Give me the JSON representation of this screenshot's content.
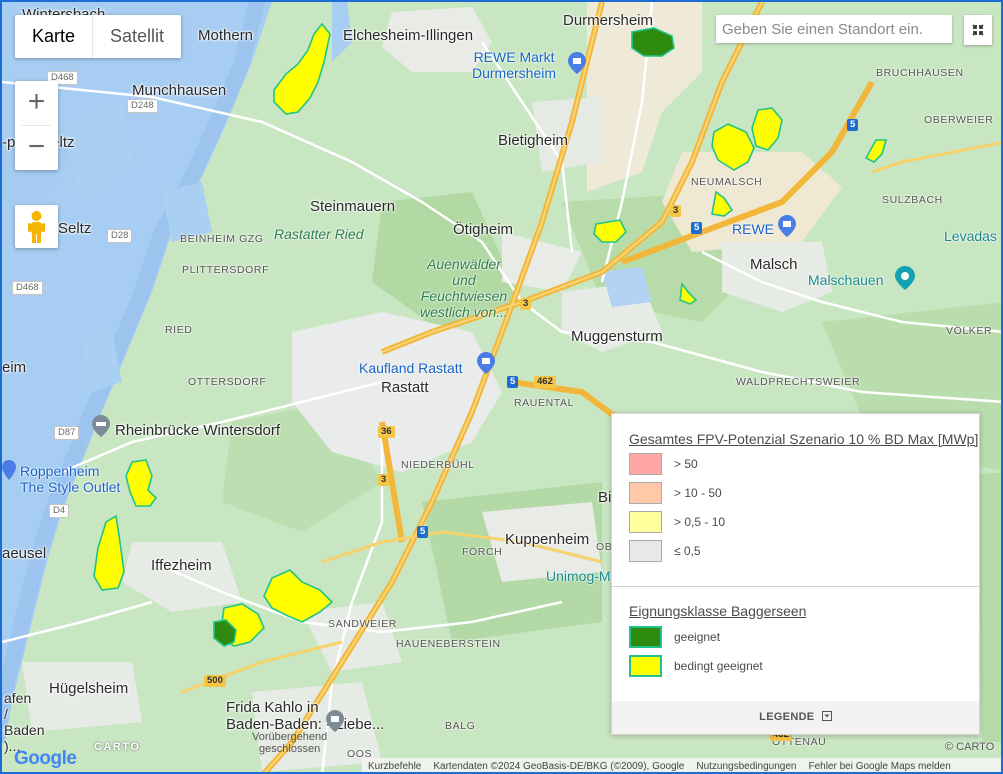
{
  "map_type": {
    "options": [
      "Karte",
      "Satellit"
    ],
    "selected": "Karte"
  },
  "zoom": {
    "in_label": "+",
    "out_label": "−"
  },
  "search": {
    "placeholder": "Geben Sie einen Standort ein."
  },
  "places": {
    "wintersbach": "Wintersbach",
    "mothern": "Mothern",
    "elchesheim": "Elchesheim-Illingen",
    "durmersheim": "Durmersheim",
    "rewe_markt": "REWE Markt\nDurmersheim",
    "munchhausen": "Munchhausen",
    "pres_seltz": "-près-Seltz",
    "bietigheim": "Bietigheim",
    "bruchhausen": "BRUCHHAUSEN",
    "oberweier": "OBERWEIER",
    "neumalsch": "NEUMALSCH",
    "sulzbach": "SULZBACH",
    "steinmauern": "Steinmauern",
    "rastatter_ried": "Rastatter Ried",
    "otigheim": "Ötigheim",
    "rewe": "REWE",
    "levadas": "Levadas",
    "seltz": "Seltz",
    "beinheim": "BEINHEIM GZG",
    "plittersdorf": "PLITTERSDORF",
    "auenwalder": "Auenwälder\nund\nFeuchtwiesen\nwestlich von...",
    "malsch": "Malsch",
    "malschauen": "Malschauen",
    "ried": "RIED",
    "muggensturm": "Muggensturm",
    "volker": "VÖLKER",
    "kaufland": "Kaufland Rastatt",
    "rastatt": "Rastatt",
    "ottersdorf": "OTTERSDORF",
    "waldprechtsweier": "WALDPRECHTSWEIER",
    "rauental": "RAUENTAL",
    "rheinbrucke": "Rheinbrücke Wintersdorf",
    "niederbuhl": "NIEDERBÜHL",
    "roppenheim": "Roppenheim\nThe Style Outlet",
    "iffezheim": "Iffezheim",
    "forch": "FÖRCH",
    "kuppenheim": "Kuppenheim",
    "unimog": "Unimog-M",
    "aeusel": "aeusel",
    "sandweier": "SANDWEIER",
    "haueneberstein": "HAUENEBERSTEIN",
    "hugelsheim": "Hügelsheim",
    "frida": "Frida Kahlo in\nBaden-Baden: - Liebe...",
    "frida_status": "Vorübergehend\ngeschlossen",
    "balg": "BALG",
    "oos": "OOS",
    "ottenau": "OTTENAU",
    "left_edge": "afen\n/\nBaden\n)...",
    "ch": "eim",
    "bi": "Bi",
    "ob": "OB"
  },
  "road_labels": {
    "d468a": "D468",
    "d248": "D248",
    "d28": "D28",
    "d468b": "D468",
    "d87": "D87",
    "d4": "D4",
    "a5a": "5",
    "a5b": "5",
    "a5c": "5",
    "a5d": "5",
    "b3a": "3",
    "b3b": "3",
    "b3c": "3",
    "b36": "36",
    "b462": "462",
    "b500": "500",
    "k462": "462"
  },
  "legend": {
    "title1": "Gesamtes FPV-Potenzial Szenario 10 % BD Max [MWp]",
    "classes": [
      {
        "label": "> 50",
        "color": "#ffa6a6"
      },
      {
        "label": "> 10 - 50",
        "color": "#ffc9a8"
      },
      {
        "label": "> 0,5 - 10",
        "color": "#ffff9e"
      },
      {
        "label": "≤ 0,5",
        "color": "#e8e8e8"
      }
    ],
    "title2": "Eignungsklasse Baggerseen",
    "suitability": [
      {
        "label": "geeignet",
        "color": "#2e8b0f"
      },
      {
        "label": "bedingt geeignet",
        "color": "#ffff00"
      }
    ],
    "toggle_label": "LEGENDE"
  },
  "footer": {
    "shortcuts": "Kurzbefehle",
    "attribution": "Kartendaten ©2024 GeoBasis-DE/BKG (©2009), Google",
    "terms": "Nutzungsbedingungen",
    "report": "Fehler bei Google Maps melden"
  },
  "watermark": {
    "google": "Google",
    "carto_left": "CARTO",
    "carto_right": "© CARTO"
  },
  "colors": {
    "water": "#9dc4ef",
    "forest": "#b5dba9",
    "urban": "#ebebeb",
    "highway": "#f5c646",
    "lake_yellow": "#ffff00",
    "lake_green": "#2e8b0f",
    "lake_border": "#20c48a"
  }
}
